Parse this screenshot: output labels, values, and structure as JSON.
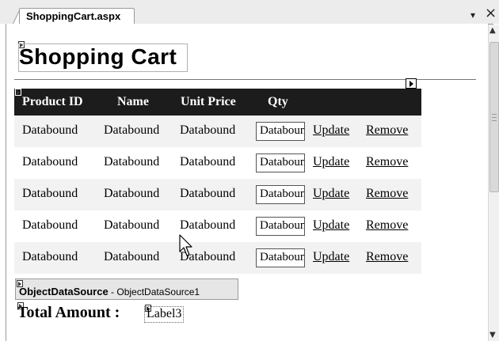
{
  "window": {
    "tab_title": "ShoppingCart.aspx",
    "tab_dropdown_glyph": "▾",
    "close_glyph": "×"
  },
  "scrollbar": {
    "up": "▲",
    "down": "▼"
  },
  "page": {
    "heading": "Shopping Cart"
  },
  "grid": {
    "columns": [
      "Product ID",
      "Name",
      "Unit Price",
      "Qty"
    ],
    "rows": [
      {
        "product_id": "Databound",
        "name": "Databound",
        "unit_price": "Databound",
        "qty": "Databound",
        "update": "Update",
        "remove": "Remove"
      },
      {
        "product_id": "Databound",
        "name": "Databound",
        "unit_price": "Databound",
        "qty": "Databound",
        "update": "Update",
        "remove": "Remove"
      },
      {
        "product_id": "Databound",
        "name": "Databound",
        "unit_price": "Databound",
        "qty": "Databound",
        "update": "Update",
        "remove": "Remove"
      },
      {
        "product_id": "Databound",
        "name": "Databound",
        "unit_price": "Databound",
        "qty": "Databound",
        "update": "Update",
        "remove": "Remove"
      },
      {
        "product_id": "Databound",
        "name": "Databound",
        "unit_price": "Databound",
        "qty": "Databound",
        "update": "Update",
        "remove": "Remove"
      }
    ]
  },
  "datasource": {
    "type_label": "ObjectDataSource",
    "separator": " - ",
    "instance_name": "ObjectDataSource1"
  },
  "total": {
    "label": "Total Amount :",
    "value_control": "Label3"
  },
  "icons": [
    "smart-tag-icon",
    "control-glyph-icon",
    "scroll-up-arrow-icon",
    "scroll-down-arrow-icon",
    "mouse-cursor-icon",
    "close-icon",
    "dropdown-arrow-icon"
  ]
}
